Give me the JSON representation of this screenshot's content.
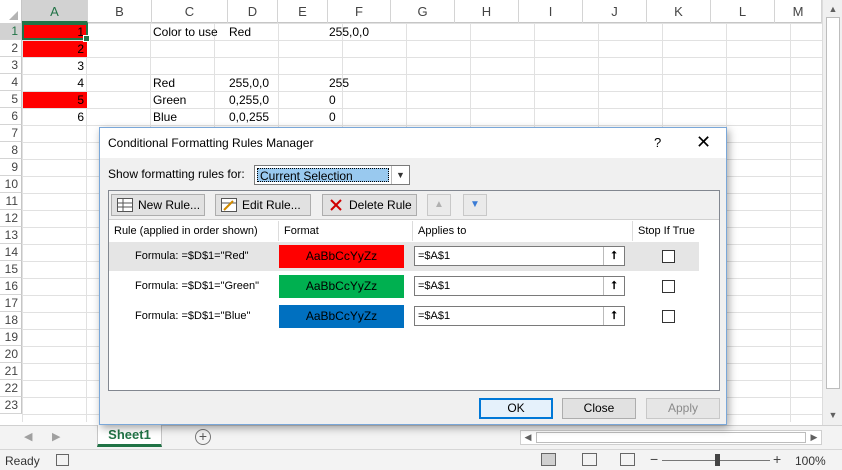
{
  "sheet": {
    "columns": [
      "A",
      "B",
      "C",
      "D",
      "E",
      "F",
      "G",
      "H",
      "I",
      "J",
      "K",
      "L",
      "M"
    ],
    "rows": [
      "1",
      "2",
      "3",
      "4",
      "5",
      "6",
      "7",
      "8",
      "9",
      "10",
      "11",
      "12",
      "13",
      "14",
      "15",
      "16",
      "17",
      "18",
      "19",
      "20",
      "21",
      "22",
      "23"
    ],
    "cells": {
      "A1": "1",
      "A2": "2",
      "A3": "3",
      "A4": "4",
      "A5": "5",
      "A6": "6",
      "C1": "Color to use",
      "D1": "Red",
      "F1": "255,0,0",
      "C4": "Red",
      "D4": "255,0,0",
      "F4": "255",
      "C5": "Green",
      "D5": "0,255,0",
      "F5": "0",
      "C6": "Blue",
      "D6": "0,0,255",
      "F6": "0"
    },
    "fill_color": "#ff0000",
    "tab_name": "Sheet1"
  },
  "statusbar": {
    "ready": "Ready",
    "zoom": "100%"
  },
  "dialog": {
    "title": "Conditional Formatting Rules Manager",
    "help": "?",
    "close": "✕",
    "show_for_label": "Show formatting rules for:",
    "show_for_value": "Current Selection",
    "toolbar": {
      "new_rule": "New Rule...",
      "edit_rule": "Edit Rule...",
      "delete_rule": "Delete Rule"
    },
    "headers": {
      "rule": "Rule (applied in order shown)",
      "format": "Format",
      "applies_to": "Applies to",
      "stop_if_true": "Stop If True"
    },
    "rules": [
      {
        "formula": "Formula: =$D$1=\"Red\"",
        "preview": "AaBbCcYyZz",
        "color": "#ff0000",
        "applies_to": "=$A$1",
        "stop": false
      },
      {
        "formula": "Formula: =$D$1=\"Green\"",
        "preview": "AaBbCcYyZz",
        "color": "#00b050",
        "applies_to": "=$A$1",
        "stop": false
      },
      {
        "formula": "Formula: =$D$1=\"Blue\"",
        "preview": "AaBbCcYyZz",
        "color": "#0070c0",
        "applies_to": "=$A$1",
        "stop": false
      }
    ],
    "buttons": {
      "ok": "OK",
      "close": "Close",
      "apply": "Apply"
    }
  }
}
